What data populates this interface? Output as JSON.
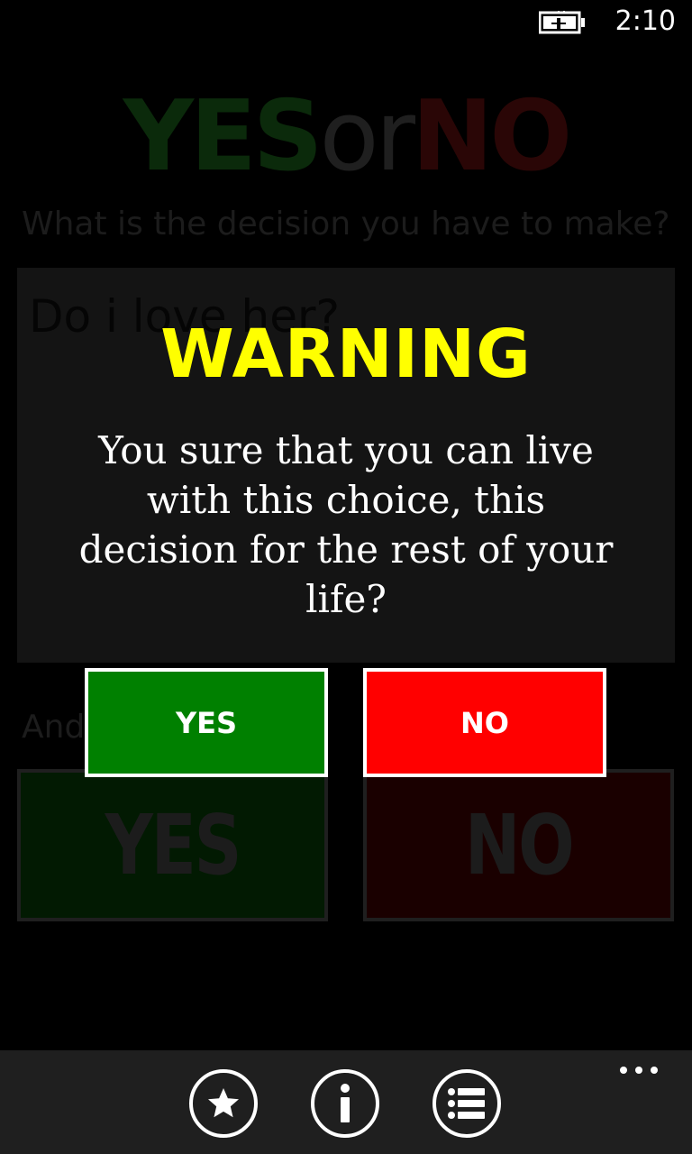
{
  "status": {
    "time": "2:10",
    "battery_icon": "battery-charging-icon"
  },
  "app": {
    "title_yes": "YES",
    "title_or": "or",
    "title_no": "NO",
    "question_label": "What is the decision you have to make?",
    "question_value": "Do i love her?",
    "answer_label": "And",
    "yes_button": "YES",
    "no_button": "NO"
  },
  "dialog": {
    "title": "WARNING",
    "message": "You sure that you can live with this choice, this decision for the rest of your life?",
    "yes_label": "YES",
    "no_label": "NO",
    "colors": {
      "title": "#ffff00",
      "yes": "#008000",
      "no": "#ff0000"
    }
  },
  "app_bar": {
    "buttons": [
      {
        "icon": "star-icon"
      },
      {
        "icon": "info-icon"
      },
      {
        "icon": "list-icon"
      }
    ],
    "more_icon": "more-dots-icon"
  }
}
